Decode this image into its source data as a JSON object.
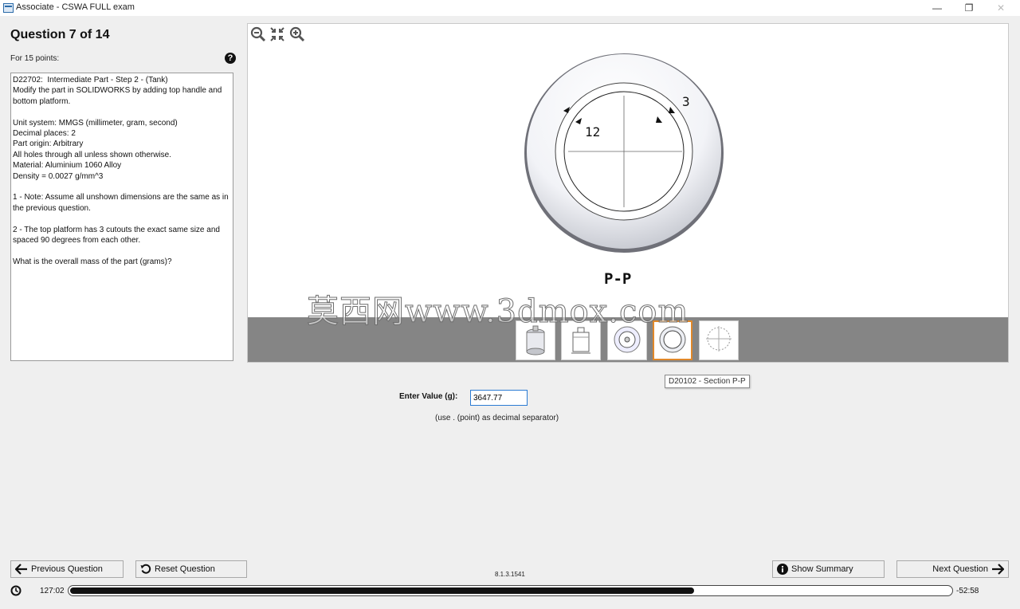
{
  "window": {
    "title": "Associate - CSWA FULL exam",
    "min": "—",
    "restore": "❐",
    "close": "✕"
  },
  "question": {
    "title": "Question 7 of 14",
    "points": "For 15 points:",
    "help": "?",
    "text": "D22702:  Intermediate Part - Step 2 - (Tank)\nModify the part in SOLIDWORKS by adding top handle and bottom platform.\n\nUnit system: MMGS (millimeter, gram, second)\nDecimal places: 2\nPart origin: Arbitrary\nAll holes through all unless shown otherwise.\nMaterial: Aluminium 1060 Alloy\nDensity = 0.0027 g/mm^3\n\n1 - Note: Assume all unshown dimensions are the same as in the previous question.\n\n2 - The top platform has 3 cutouts the exact same size and spaced 90 degrees from each other.\n\nWhat is the overall mass of the part (grams)?"
  },
  "viewer": {
    "dim_outer": "3",
    "dim_inner": "12",
    "section_label": "P-P",
    "zoom_icons": [
      "zoom-out-icon",
      "fit-icon",
      "zoom-in-icon"
    ],
    "thumb_selected": 3,
    "watermark": "莫西网www.3dmox.com",
    "tooltip": "D20102 - Section P-P"
  },
  "answer": {
    "label": "Enter Value (g):",
    "value": "3647.77",
    "hint": "(use . (point) as decimal separator)"
  },
  "footer": {
    "prev": "Previous Question",
    "reset": "Reset Question",
    "version": "8.1.3.1541",
    "summary": "Show Summary",
    "next": "Next Question",
    "elapsed": "127:02",
    "remaining": "-52:58",
    "progress": 0.71
  },
  "colors": {
    "accent": "#2b7cd3",
    "thumb_selected": "#e0882a",
    "thumb_bar": "#858585"
  }
}
